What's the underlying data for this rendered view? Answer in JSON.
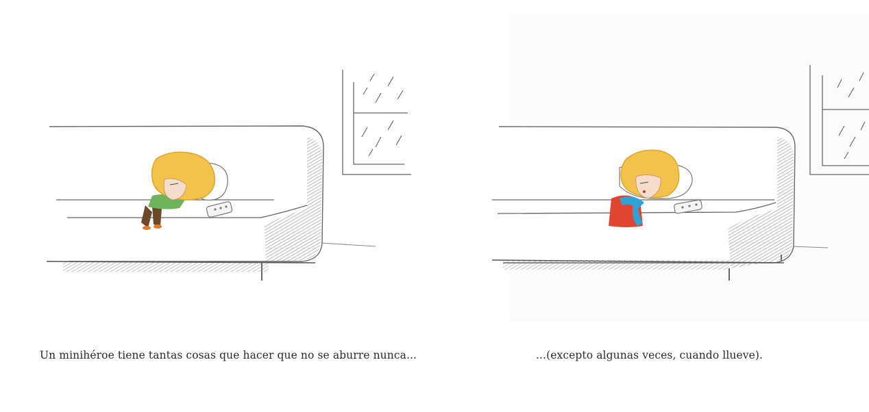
{
  "book": {
    "spread": {
      "left_page": {
        "caption": "Un minihéroe tiene tantas cosas que hacer que no se aburre nunca..."
      },
      "right_page": {
        "caption": "...(excepto algunas veces, cuando llueve)."
      }
    }
  },
  "colors": {
    "hair": "#f2c24a",
    "hair_shadow": "#e0a52c",
    "green_shirt": "#6db35a",
    "brown_pants": "#6b4a2a",
    "orange_shoes": "#e27a2a",
    "red_cape": "#e2452f",
    "blue_scarf": "#2fa3d6",
    "pencil": "#555555"
  }
}
